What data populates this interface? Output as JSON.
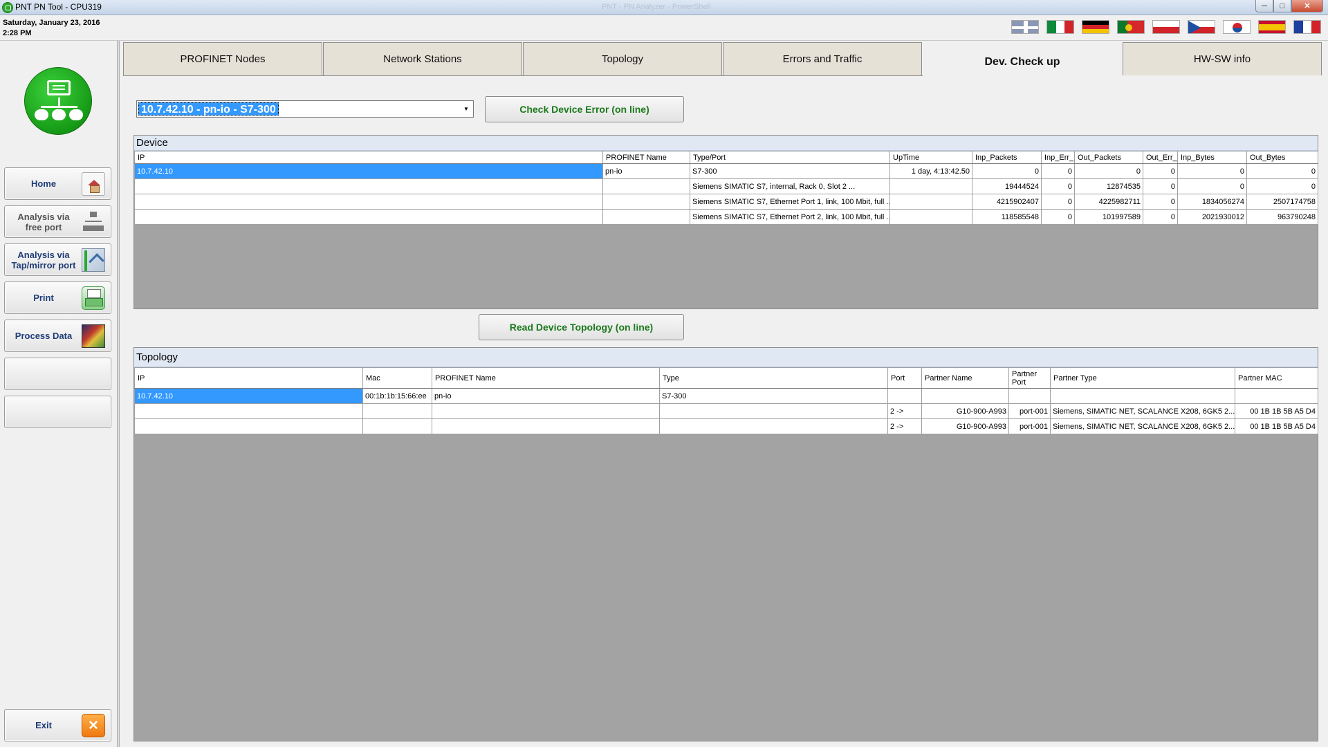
{
  "window": {
    "title": "PNT PN Tool - CPU319",
    "faint_title": "PNT - PN Analyzer - PowerShell",
    "min": "─",
    "max": "□",
    "close": "✕"
  },
  "datetime": {
    "date": "Saturday, January 23, 2016",
    "time": "2:28 PM"
  },
  "flags": [
    "uk-flag",
    "italy-flag",
    "germany-flag",
    "portugal-flag",
    "poland-flag",
    "czech-flag",
    "korea-flag",
    "spain-flag",
    "france-flag"
  ],
  "sidebar": {
    "home": "Home",
    "free_port": "Analysis via free port",
    "tap_port": "Analysis via Tap/mirror port",
    "print": "Print",
    "process": "Process Data",
    "exit": "Exit",
    "exit_glyph": "✕"
  },
  "tabs": [
    "PROFINET Nodes",
    "Network Stations",
    "Topology",
    "Errors and Traffic",
    "Dev. Check up",
    "HW-SW info"
  ],
  "active_tab": "Dev. Check up",
  "device_select": {
    "value": "10.7.42.10  -  pn-io  -  S7-300",
    "arrow": "▼"
  },
  "buttons": {
    "check_error": "Check Device Error (on line)",
    "read_topology": "Read Device Topology (on line)"
  },
  "device_panel": {
    "title": "Device",
    "columns": [
      "IP",
      "PROFINET Name",
      "Type/Port",
      "UpTime",
      "Inp_Packets",
      "Inp_Err_",
      "Out_Packets",
      "Out_Err_",
      "Inp_Bytes",
      "Out_Bytes"
    ],
    "rows": [
      [
        "10.7.42.10",
        "pn-io",
        "S7-300",
        "1 day, 4:13:42.50",
        "0",
        "0",
        "0",
        "0",
        "0",
        "0"
      ],
      [
        "",
        "",
        "Siemens SIMATIC S7, internal, Rack 0, Slot 2        ...",
        "",
        "19444524",
        "0",
        "12874535",
        "0",
        "0",
        "0"
      ],
      [
        "",
        "",
        "Siemens SIMATIC S7, Ethernet Port 1, link, 100 Mbit, full ...",
        "",
        "4215902407",
        "0",
        "4225982711",
        "0",
        "1834056274",
        "2507174758"
      ],
      [
        "",
        "",
        "Siemens SIMATIC S7, Ethernet Port 2, link, 100 Mbit, full ...",
        "",
        "118585548",
        "0",
        "101997589",
        "0",
        "2021930012",
        "963790248"
      ]
    ]
  },
  "topology_panel": {
    "title": "Topology",
    "columns": [
      "IP",
      "Mac",
      "PROFINET Name",
      "Type",
      "Port",
      "Partner Name",
      "Partner Port",
      "Partner Type",
      "Partner MAC"
    ],
    "rows": [
      [
        "10.7.42.10",
        "00:1b:1b:15:66:ee",
        "pn-io",
        "S7-300",
        "",
        "",
        "",
        "",
        ""
      ],
      [
        "",
        "",
        "",
        "",
        "2  ->",
        "G10-900-A993",
        "port-001",
        "Siemens, SIMATIC NET, SCALANCE X208, 6GK5 2...",
        "00 1B 1B 5B A5 D4"
      ],
      [
        "",
        "",
        "",
        "",
        "2  ->",
        "G10-900-A993",
        "port-001",
        "Siemens, SIMATIC NET, SCALANCE X208, 6GK5 2...",
        "00 1B 1B 5B A5 D4"
      ]
    ]
  }
}
